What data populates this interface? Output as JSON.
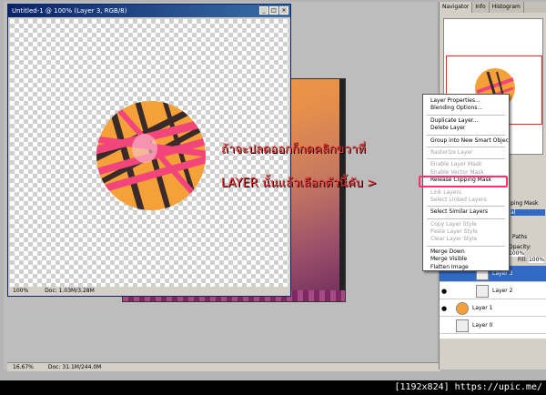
{
  "document_window": {
    "title": "Untitled-1 @ 100% (Layer 3, RGB/8)",
    "zoom": "100%",
    "doc_size": "Doc: 1.03M/3.28M"
  },
  "workspace_status": {
    "zoom": "16.67%",
    "doc_size": "Doc: 31.1M/244.0M"
  },
  "annotation": {
    "line1": "ถ้าจะปลดออกก็กดคลิกขวาที่",
    "line2": "LAYER นั้นแล้วเลือกตัวนี้คับ  >"
  },
  "panel_tabs": [
    "Navigator",
    "Info",
    "Histogram"
  ],
  "context_menu": {
    "items": [
      {
        "label": "Layer Properties...",
        "disabled": false
      },
      {
        "label": "Blending Options...",
        "disabled": false
      },
      {
        "sep": true
      },
      {
        "label": "Duplicate Layer...",
        "disabled": false
      },
      {
        "label": "Delete Layer",
        "disabled": false
      },
      {
        "sep": true
      },
      {
        "label": "Group into New Smart Object",
        "disabled": false
      },
      {
        "sep": true
      },
      {
        "label": "Rasterize Layer",
        "disabled": true
      },
      {
        "sep": true
      },
      {
        "label": "Enable Layer Mask",
        "disabled": true
      },
      {
        "label": "Enable Vector Mask",
        "disabled": true
      },
      {
        "label": "Release Clipping Mask",
        "disabled": false
      },
      {
        "sep": true
      },
      {
        "label": "Link Layers",
        "disabled": true
      },
      {
        "label": "Select Linked Layers",
        "disabled": true
      },
      {
        "sep": true
      },
      {
        "label": "Select Similar Layers",
        "disabled": false
      },
      {
        "sep": true
      },
      {
        "label": "Copy Layer Style",
        "disabled": true
      },
      {
        "label": "Paste Layer Style",
        "disabled": true
      },
      {
        "label": "Clear Layer Style",
        "disabled": true
      },
      {
        "sep": true
      },
      {
        "label": "Merge Down",
        "disabled": false
      },
      {
        "label": "Merge Visible",
        "disabled": false
      },
      {
        "label": "Flatten Image",
        "disabled": false
      }
    ]
  },
  "layers_panel": {
    "fragments": {
      "clipping": "ping Mask",
      "normal": "al",
      "paths": "Paths",
      "opacity": "Opacity:",
      "opacity_value": "100%",
      "fill": "Fill:",
      "fill_value": "100%"
    },
    "layers": [
      {
        "name": "Layer 3"
      },
      {
        "name": "Layer 2"
      },
      {
        "name": "Layer 1"
      },
      {
        "name": "Layer 0"
      }
    ]
  },
  "footer": "[1192x824] https://upic.me/",
  "colors": {
    "highlight_border": "#ff3070",
    "annotation_text": "#ff3030",
    "circle_fill": "#f4a13a",
    "stripe_pink": "#f2457a",
    "stripe_dark": "#3a2a2a"
  }
}
